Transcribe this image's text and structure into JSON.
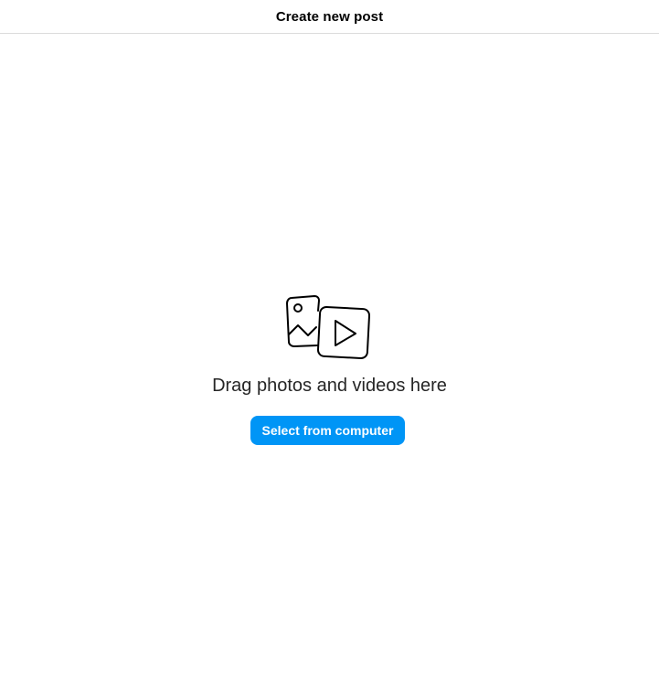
{
  "header": {
    "title": "Create new post"
  },
  "upload": {
    "icon": "photo-video-media-icon",
    "prompt": "Drag photos and videos here",
    "button_label": "Select from computer"
  },
  "colors": {
    "button_bg": "#0095f6",
    "button_text": "#ffffff",
    "divider": "#dbdbdb",
    "text": "#262626"
  }
}
